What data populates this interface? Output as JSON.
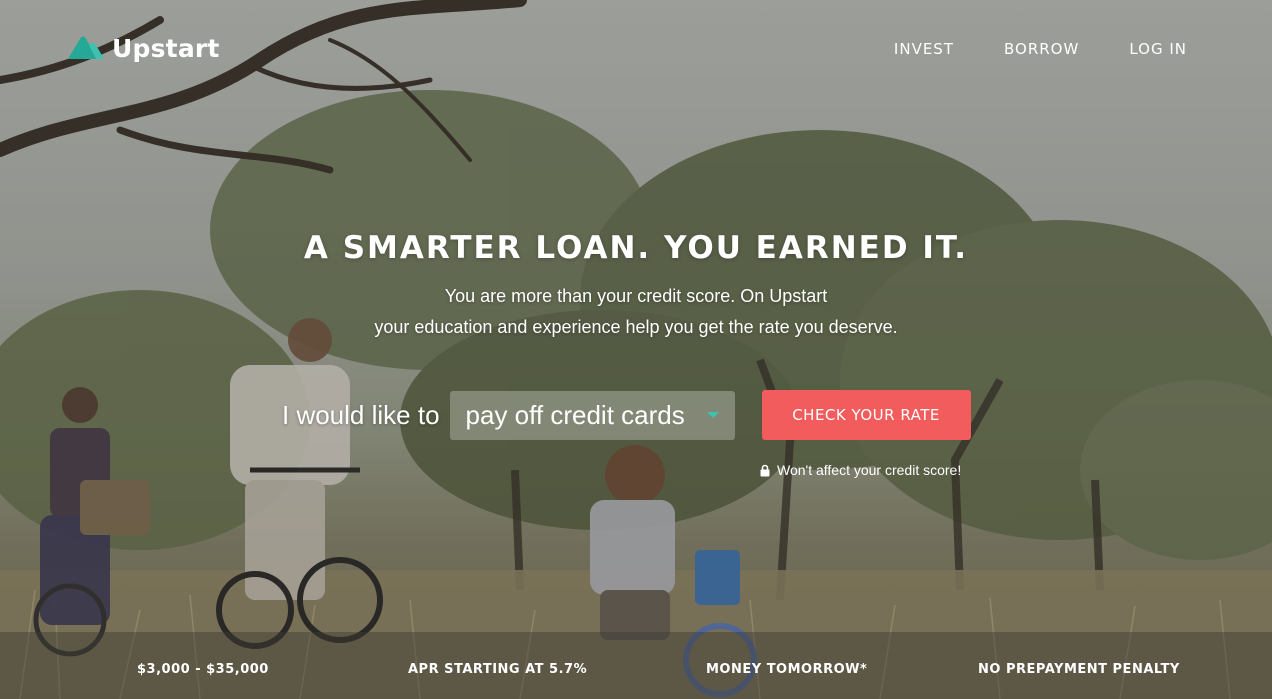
{
  "brand": {
    "name": "Upstart",
    "accent_color": "#3fc1b0",
    "cta_color": "#f25c5c"
  },
  "nav": {
    "items": [
      {
        "label": "INVEST"
      },
      {
        "label": "BORROW"
      },
      {
        "label": "LOG IN"
      }
    ]
  },
  "hero": {
    "headline": "A SMARTER LOAN. YOU EARNED IT.",
    "subtitle_line1": "You are more than your credit score. On Upstart",
    "subtitle_line2": "your education and experience help you get the rate you deserve."
  },
  "form": {
    "prefix": "I would like to",
    "goal_selected": "pay off credit cards",
    "cta_label": "CHECK YOUR RATE",
    "note": "Won't affect your credit score!",
    "note_icon": "lock-icon"
  },
  "features": [
    {
      "label": "$3,000 - $35,000"
    },
    {
      "label": "APR STARTING AT 5.7%"
    },
    {
      "label": "MONEY TOMORROW*"
    },
    {
      "label": "NO PREPAYMENT PENALTY"
    }
  ]
}
